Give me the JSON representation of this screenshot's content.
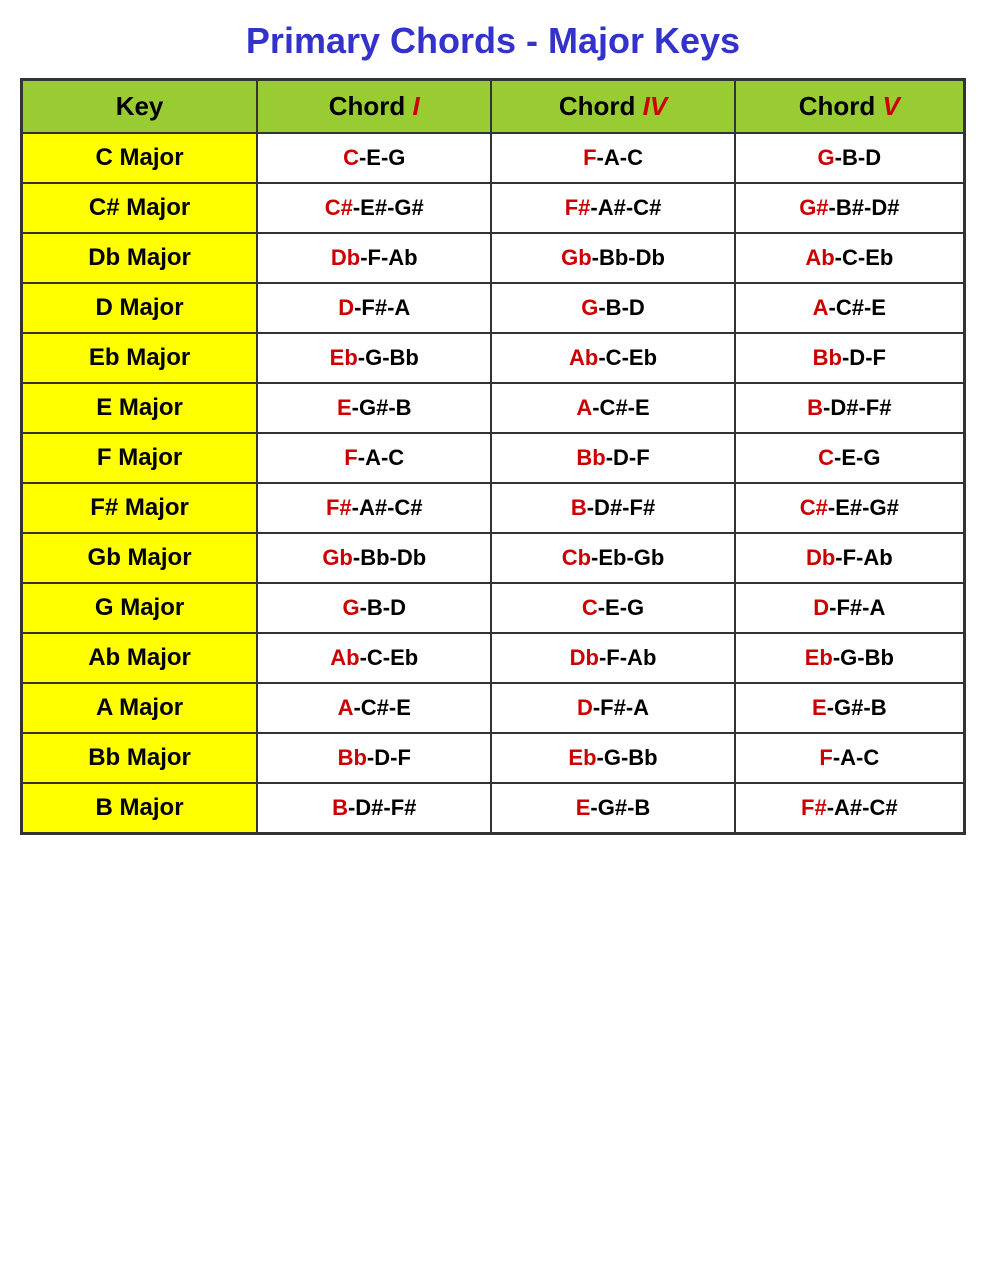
{
  "title": "Primary Chords - Major Keys",
  "headers": {
    "key": "Key",
    "chord1": "Chord",
    "chord1_roman": "I",
    "chord4": "Chord",
    "chord4_roman": "IV",
    "chord5": "Chord",
    "chord5_roman": "V"
  },
  "rows": [
    {
      "key": "C Major",
      "chord1_root": "C",
      "chord1_rest": "-E-G",
      "chord4_root": "F",
      "chord4_rest": "-A-C",
      "chord5_root": "G",
      "chord5_rest": "-B-D"
    },
    {
      "key": "C# Major",
      "chord1_root": "C#",
      "chord1_rest": "-E#-G#",
      "chord4_root": "F#",
      "chord4_rest": "-A#-C#",
      "chord5_root": "G#",
      "chord5_rest": "-B#-D#"
    },
    {
      "key": "Db Major",
      "chord1_root": "Db",
      "chord1_rest": "-F-Ab",
      "chord4_root": "Gb",
      "chord4_rest": "-Bb-Db",
      "chord5_root": "Ab",
      "chord5_rest": "-C-Eb"
    },
    {
      "key": "D Major",
      "chord1_root": "D",
      "chord1_rest": "-F#-A",
      "chord4_root": "G",
      "chord4_rest": "-B-D",
      "chord5_root": "A",
      "chord5_rest": "-C#-E"
    },
    {
      "key": "Eb Major",
      "chord1_root": "Eb",
      "chord1_rest": "-G-Bb",
      "chord4_root": "Ab",
      "chord4_rest": "-C-Eb",
      "chord5_root": "Bb",
      "chord5_rest": "-D-F"
    },
    {
      "key": "E Major",
      "chord1_root": "E",
      "chord1_rest": "-G#-B",
      "chord4_root": "A",
      "chord4_rest": "-C#-E",
      "chord5_root": "B",
      "chord5_rest": "-D#-F#"
    },
    {
      "key": "F Major",
      "chord1_root": "F",
      "chord1_rest": "-A-C",
      "chord4_root": "Bb",
      "chord4_rest": "-D-F",
      "chord5_root": "C",
      "chord5_rest": "-E-G"
    },
    {
      "key": "F# Major",
      "chord1_root": "F#",
      "chord1_rest": "-A#-C#",
      "chord4_root": "B",
      "chord4_rest": "-D#-F#",
      "chord5_root": "C#",
      "chord5_rest": "-E#-G#"
    },
    {
      "key": "Gb Major",
      "chord1_root": "Gb",
      "chord1_rest": "-Bb-Db",
      "chord4_root": "Cb",
      "chord4_rest": "-Eb-Gb",
      "chord5_root": "Db",
      "chord5_rest": "-F-Ab"
    },
    {
      "key": "G Major",
      "chord1_root": "G",
      "chord1_rest": "-B-D",
      "chord4_root": "C",
      "chord4_rest": "-E-G",
      "chord5_root": "D",
      "chord5_rest": "-F#-A"
    },
    {
      "key": "Ab Major",
      "chord1_root": "Ab",
      "chord1_rest": "-C-Eb",
      "chord4_root": "Db",
      "chord4_rest": "-F-Ab",
      "chord5_root": "Eb",
      "chord5_rest": "-G-Bb"
    },
    {
      "key": "A Major",
      "chord1_root": "A",
      "chord1_rest": "-C#-E",
      "chord4_root": "D",
      "chord4_rest": "-F#-A",
      "chord5_root": "E",
      "chord5_rest": "-G#-B"
    },
    {
      "key": "Bb Major",
      "chord1_root": "Bb",
      "chord1_rest": "-D-F",
      "chord4_root": "Eb",
      "chord4_rest": "-G-Bb",
      "chord5_root": "F",
      "chord5_rest": "-A-C"
    },
    {
      "key": "B Major",
      "chord1_root": "B",
      "chord1_rest": "-D#-F#",
      "chord4_root": "E",
      "chord4_rest": "-G#-B",
      "chord5_root": "F#",
      "chord5_rest": "-A#-C#"
    }
  ]
}
